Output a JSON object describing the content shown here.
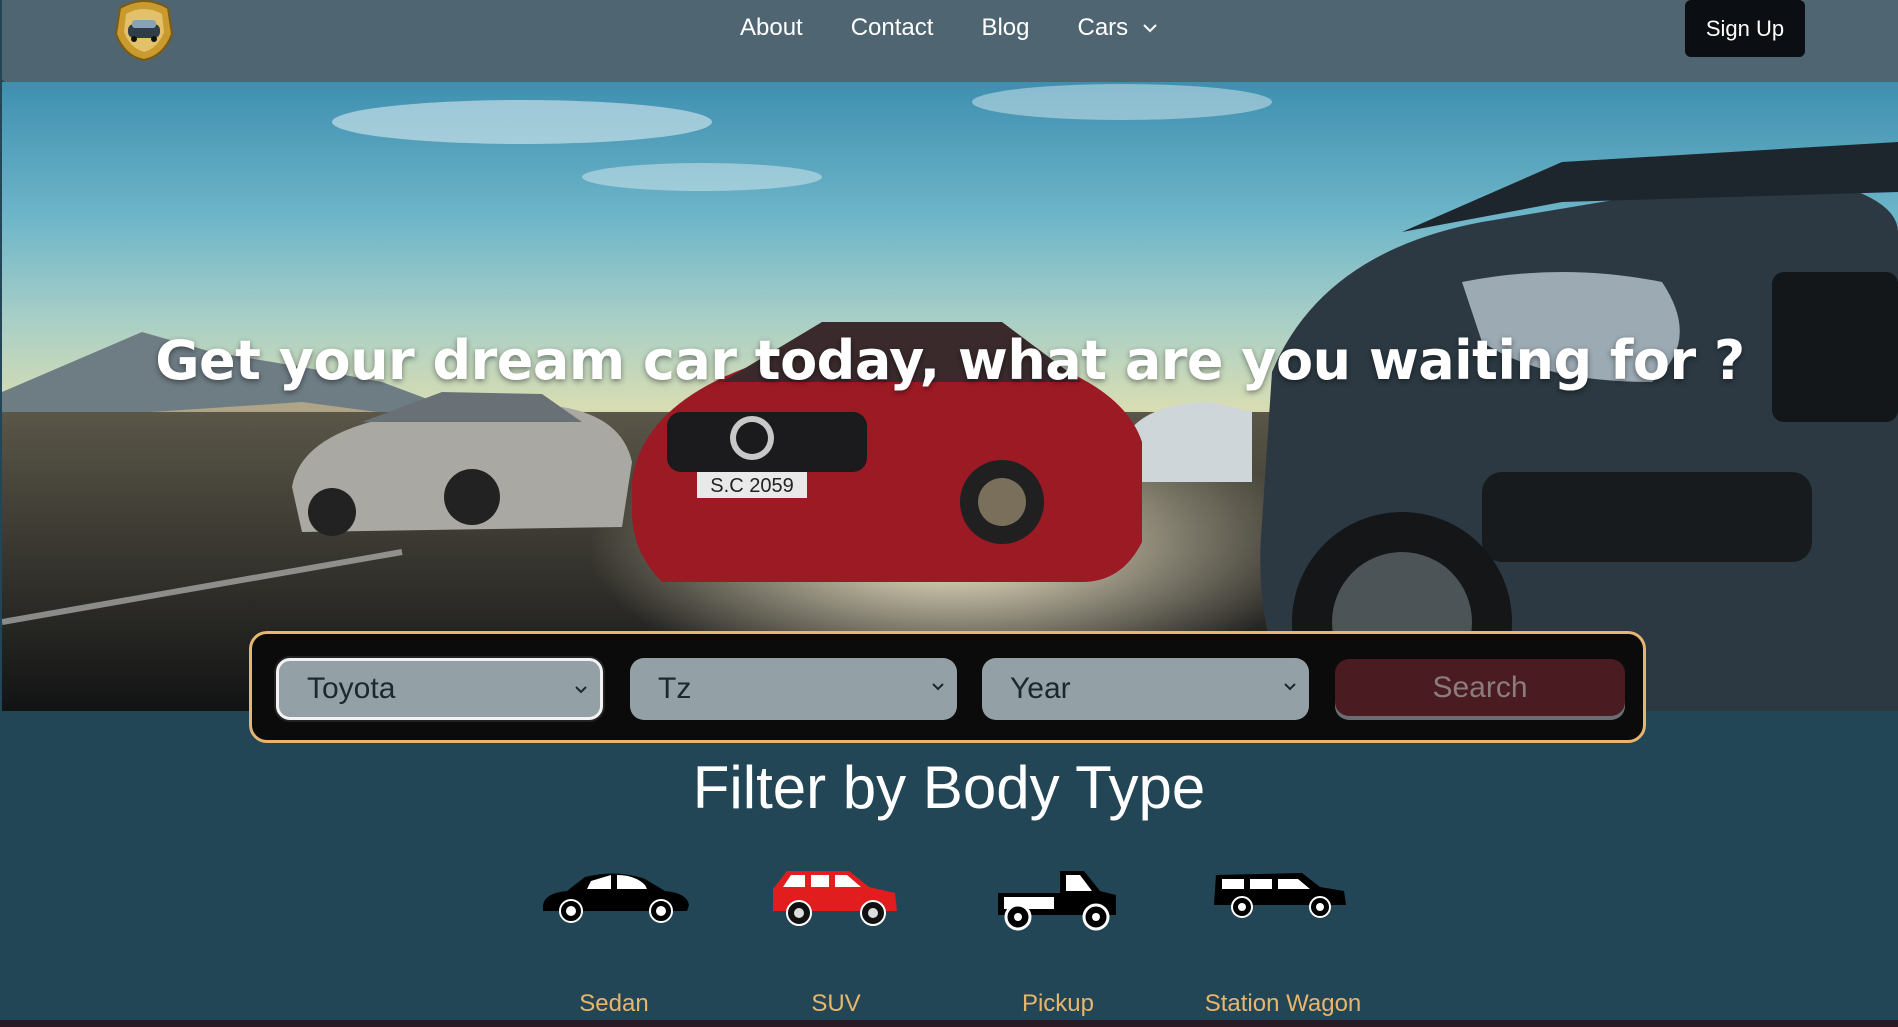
{
  "nav": {
    "logo_icon": "car-crest-logo-icon",
    "links": [
      "About",
      "Contact",
      "Blog",
      "Cars"
    ],
    "cars_dropdown_icon": "chevron-down-icon",
    "signup_label": "Sign Up"
  },
  "hero": {
    "headline": "Get your dream car today, what are you waiting for ?",
    "plate_text": "S.C 2059"
  },
  "search": {
    "make": "Toyota",
    "model": "Tz",
    "year": "Year",
    "button_label": "Search"
  },
  "filter": {
    "title": "Filter by Body Type",
    "types": [
      {
        "label": "Sedan",
        "icon": "sedan-icon",
        "color": "#000000"
      },
      {
        "label": "SUV",
        "icon": "suv-icon",
        "color": "#e11d1d"
      },
      {
        "label": "Pickup",
        "icon": "pickup-icon",
        "color": "#000000"
      },
      {
        "label": "Station Wagon",
        "icon": "station-wagon-icon",
        "color": "#000000"
      }
    ]
  },
  "colors": {
    "nav_bg": "#4f6672",
    "page_bg": "#234656",
    "accent_gold": "#e8b56d",
    "search_button_bg": "#4a1c22"
  }
}
